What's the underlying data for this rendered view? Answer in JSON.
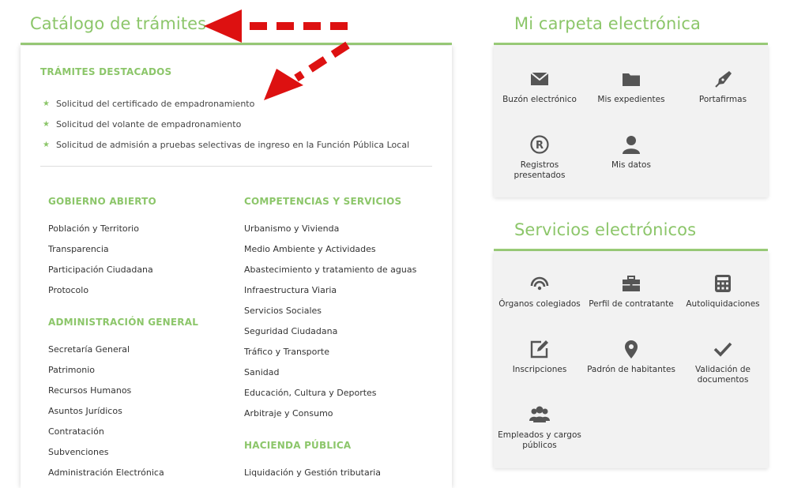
{
  "catalog": {
    "title": "Catálogo de trámites",
    "featured_heading": "TRÁMITES DESTACADOS",
    "featured": [
      "Solicitud del certificado de empadronamiento",
      "Solicitud del volante de empadronamiento",
      "Solicitud de admisión a pruebas selectivas de ingreso en la Función Pública Local"
    ],
    "gobierno": {
      "heading": "GOBIERNO ABIERTO",
      "items": [
        "Población y Territorio",
        "Transparencia",
        "Participación Ciudadana",
        "Protocolo"
      ]
    },
    "administracion": {
      "heading": "ADMINISTRACIÓN GENERAL",
      "items": [
        "Secretaría General",
        "Patrimonio",
        "Recursos Humanos",
        "Asuntos Jurídicos",
        "Contratación",
        "Subvenciones",
        "Administración Electrónica"
      ]
    },
    "competencias": {
      "heading": "COMPETENCIAS Y SERVICIOS",
      "items": [
        "Urbanismo y Vivienda",
        "Medio Ambiente y Actividades",
        "Abastecimiento y tratamiento de aguas",
        "Infraestructura Viaria",
        "Servicios Sociales",
        "Seguridad Ciudadana",
        "Tráfico y Transporte",
        "Sanidad",
        "Educación, Cultura y Deportes",
        "Arbitraje y Consumo"
      ]
    },
    "hacienda": {
      "heading": "HACIENDA PÚBLICA",
      "items": [
        "Liquidación y Gestión tributaria"
      ]
    }
  },
  "carpeta": {
    "title": "Mi carpeta electrónica",
    "tiles": [
      {
        "label": "Buzón electrónico",
        "icon": "envelope-icon"
      },
      {
        "label": "Mis expedientes",
        "icon": "folder-icon"
      },
      {
        "label": "Portafirmas",
        "icon": "pen-nib-icon"
      },
      {
        "label": "Registros presentados",
        "icon": "registered-icon"
      },
      {
        "label": "Mis datos",
        "icon": "user-icon"
      }
    ]
  },
  "servicios": {
    "title": "Servicios electrónicos",
    "tiles": [
      {
        "label": "Órganos colegiados",
        "icon": "signal-icon"
      },
      {
        "label": "Perfil de contratante",
        "icon": "briefcase-icon"
      },
      {
        "label": "Autoliquidaciones",
        "icon": "calculator-icon"
      },
      {
        "label": "Inscripciones",
        "icon": "edit-icon"
      },
      {
        "label": "Padrón de habitantes",
        "icon": "map-marker-icon"
      },
      {
        "label": "Validación de documentos",
        "icon": "check-icon"
      },
      {
        "label": "Empleados y cargos públicos",
        "icon": "group-icon"
      }
    ]
  },
  "colors": {
    "accent": "#8cc66a",
    "annotation": "#dd1111",
    "panel_bg": "#f2f2f2",
    "icon": "#555555"
  }
}
